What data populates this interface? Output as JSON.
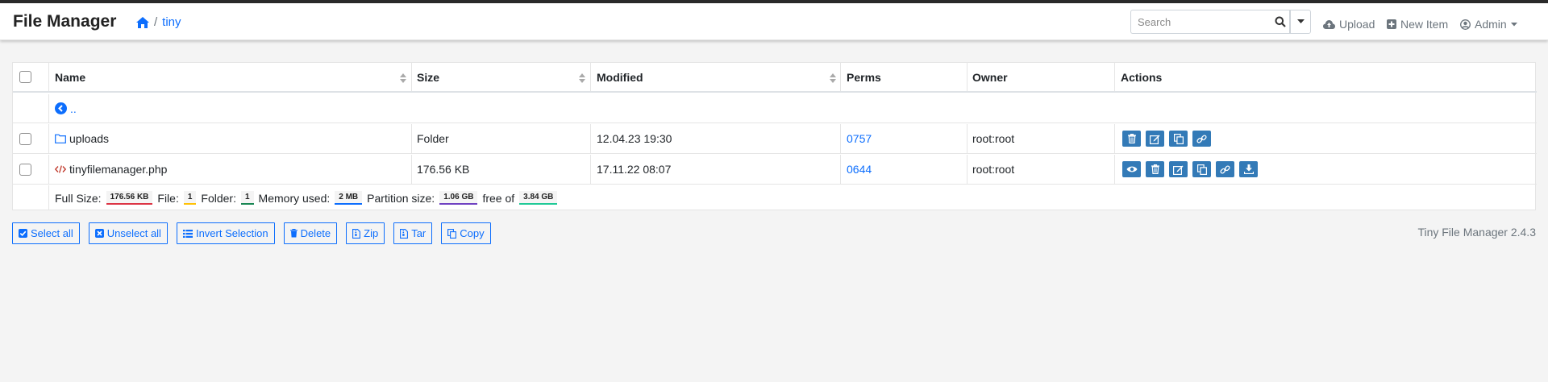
{
  "app": {
    "title": "File Manager"
  },
  "breadcrumb": {
    "separator": "/",
    "current": "tiny"
  },
  "search": {
    "placeholder": "Search",
    "value": ""
  },
  "nav": {
    "upload": "Upload",
    "new_item": "New Item",
    "user": "Admin"
  },
  "table": {
    "headers": {
      "name": "Name",
      "size": "Size",
      "modified": "Modified",
      "perms": "Perms",
      "owner": "Owner",
      "actions": "Actions"
    },
    "parent": "..",
    "rows": [
      {
        "name": "uploads",
        "size": "Folder",
        "modified": "12.04.23 19:30",
        "perms": "0757",
        "owner": "root:root",
        "type": "folder",
        "actions": [
          "delete",
          "rename",
          "copy",
          "direct-link"
        ]
      },
      {
        "name": "tinyfilemanager.php",
        "size": "176.56 KB",
        "modified": "17.11.22 08:07",
        "perms": "0644",
        "owner": "root:root",
        "type": "php",
        "actions": [
          "view",
          "delete",
          "rename",
          "copy",
          "direct-link",
          "download"
        ]
      }
    ],
    "footer": {
      "full_size_label": "Full Size:",
      "full_size": "176.56 KB",
      "file_label": "File:",
      "file": "1",
      "folder_label": "Folder:",
      "folder": "1",
      "memory_label": "Memory used:",
      "memory": "2 MB",
      "partition_label": "Partition size:",
      "partition": "1.06 GB",
      "free_label": "free of",
      "free": "3.84 GB"
    }
  },
  "buttons": {
    "select_all": "Select all",
    "unselect_all": "Unselect all",
    "invert": "Invert Selection",
    "delete": "Delete",
    "zip": "Zip",
    "tar": "Tar",
    "copy": "Copy"
  },
  "version": "Tiny File Manager 2.4.3",
  "colors": {
    "accent": "#0d6efd",
    "action_button": "#337ab7",
    "badge_size": "#dc3545",
    "badge_file": "#ffc107",
    "badge_folder": "#198754",
    "badge_memory": "#0d6efd",
    "badge_partition": "#6f42c1",
    "badge_free": "#20c997"
  }
}
